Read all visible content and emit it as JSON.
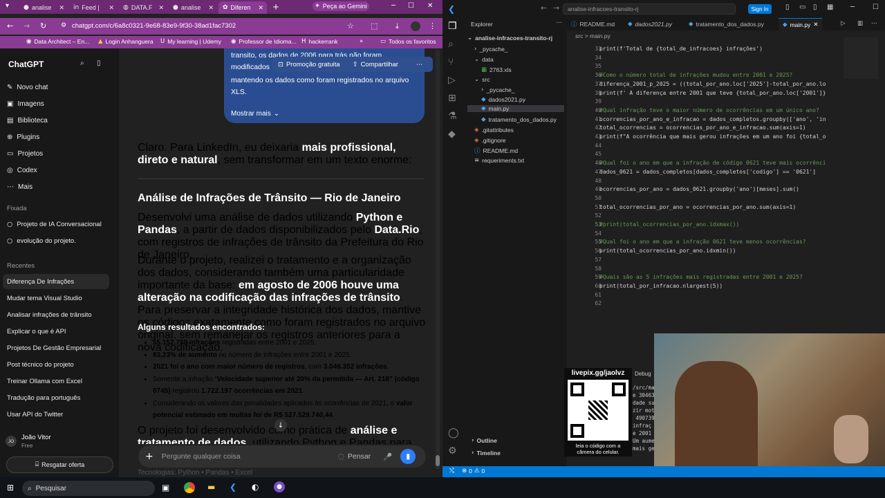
{
  "browser": {
    "tabs": [
      {
        "label": "analise"
      },
      {
        "label": "Feed |"
      },
      {
        "label": "DATA.F"
      },
      {
        "label": "analise"
      },
      {
        "label": "Diferen"
      }
    ],
    "gemini_label": "Peça ao Gemini",
    "url": "chatgpt.com/c/6a8c0321-9e68-83e9-9f30-38ad1fac7302",
    "bookmarks": [
      "Data Architect – En...",
      "Login Anhanguera",
      "My learning | Udemy",
      "Professor de Idioma...",
      "hackerrank",
      "Todos os favoritos"
    ]
  },
  "sidebar": {
    "title": "ChatGPT",
    "nav": [
      "Novo chat",
      "Imagens",
      "Biblioteca",
      "Plugins",
      "Projetos",
      "Codex",
      "Mais"
    ],
    "pinned_header": "Fixada",
    "pinned": [
      "Projeto de IA Conversacional",
      "evolução do projeto."
    ],
    "recent_header": "Recentes",
    "recent": [
      "Diferença De Infrações",
      "Mudar tema Visual Studio",
      "Analisar infrações de trânsito",
      "Explicar o que é API",
      "Projetos De Gestão Empresarial",
      "Post técnico do projeto",
      "Treinar Ollama com Excel",
      "Tradução para português",
      "Usar API do Twitter"
    ],
    "user_initials": "JO",
    "user_name": "João Vitor",
    "user_plan": "Free",
    "offer_button": "Resgatar oferta"
  },
  "chat": {
    "bubble_lines": [
      "transito, os dados de 2006 para trás não foram",
      "modificados",
      "mantendo os dados como foram registrados no arquivo",
      "XLS."
    ],
    "promo_label": "Promoção gratuita",
    "share_label": "Compartilhar",
    "show_more": "Mostrar mais",
    "intro_a": "Claro. Para LinkedIn, eu deixaria ",
    "intro_b": "mais profissional, direto e natural",
    "intro_c": ", sem transformar em um texto enorme:",
    "post_title": "Análise de Infrações de Trânsito — Rio de Janeiro",
    "p1_a": "Desenvolvi uma análise de dados utilizando ",
    "p1_b": "Python e Pandas",
    "p1_c": ", a partir de dados disponibilizados pelo ",
    "p1_d": "Data.Rio",
    "p1_e": ", com registros de infrações de trânsito da Prefeitura do Rio de Janeiro.",
    "p2_a": "Durante o projeto, realizei o tratamento e a organização dos dados, considerando também uma particularidade importante da base: ",
    "p2_b": "em agosto de 2006 houve uma alteração na codificação das infrações de trânsito",
    "p2_c": ". Para preservar a integridade histórica dos dados, mantive os códigos exatamente como foram registrados no arquivo original, sem remanejar os registros anteriores para a nova codificação.",
    "results_title": "Alguns resultados encontrados:",
    "r1_b": "55.152.759 infrações",
    "r1_t": " registradas entre 2001 e 2025.",
    "r2_b": "83,23% de aumento",
    "r2_t": " no número de infrações entre 2001 e 2025.",
    "r3_b": "2021 foi o ano com maior número de registros",
    "r3_t": ", com ",
    "r3_b2": "3.046.352 infrações",
    "r4_t": "Somente a infração “",
    "r4_b": "Velocidade superior até 20% da permitida — Art. 218”",
    "r4_b2": "(código 0745)",
    "r4_t2": " registrou ",
    "r4_b3": "1.722.197 ocorrências em 2021",
    "r5_t": "Considerando os valores das penalidades aplicados às ocorrências de 2021, o ",
    "r5_b": "valor potencial estimado em multas foi de R$ 527.529.740,44",
    "p3_a": "O projeto foi desenvolvido como prática de ",
    "p3_b": "análise e tratamento de dados",
    "p3_c": ", utilizando Python e Pandas para transformar uma base extensa em informações que podem ser",
    "tech_line": "Tecnologias: Python • Pandas • Excel",
    "input_placeholder": "Pergunte qualquer coisa",
    "think_label": "Pensar"
  },
  "vscode": {
    "title": "analise-infracoes-transito-rj",
    "signin": "Sign In",
    "explorer_title": "Explorer",
    "project": "analise-infracoes-transito-rj",
    "tree": [
      "_pycache_",
      "data",
      "2763.xls",
      "src",
      "_pycache_",
      "dados2021.py",
      "main.py",
      "tratamento_dos_dados.py",
      ".gitattributes",
      ".gitignore",
      "README.md",
      "requeriments.txt"
    ],
    "outline": "Outline",
    "timeline": "Timeline",
    "tabs": [
      "README.md",
      "dados2021.py",
      "tratamento_dos_dados.py",
      "main.py"
    ],
    "breadcrumb": "src > main.py",
    "line_numbers": [
      "33",
      "34",
      "35",
      "36",
      "37",
      "38",
      "39",
      "40",
      "41",
      "42",
      "43",
      "44",
      "45",
      "46",
      "47",
      "48",
      "49",
      "50",
      "51",
      "52",
      "53",
      "54",
      "55",
      "56",
      "57",
      "58",
      "59",
      "60",
      "61",
      "62"
    ],
    "code_lines": [
      "print(f'Total de {total_de_infracoes} infrações')",
      "",
      "",
      "#Como o número total de infrações mudou entre 2001 e 2025?",
      "diferença_2001_p_2025 = ((total_por_ano.loc['2025']-total_por_ano.lo",
      "print(f' A diferença entre 2001 que teve {total_por_ano.loc['2001']}",
      "",
      "#Qual infração teve o maior número de ocorrências em um único ano?",
      "ocorrencias_por_ano_e_infracao = dados_completos.groupby(['ano', 'in",
      "total_ocorrencias = ocorrencias_por_ano_e_infracao.sum(axis=1)",
      "print(f\"A ocorrência que mais gerou infrações em um ano foi {total_o",
      "",
      "",
      "#Qual foi o ano em que a infração de código 0621 teve mais ocorrênci",
      "dados_0621 = dados_completos[dados_completos['codigo'] == '0621']",
      "",
      "ocorrencias_por_ano = dados_0621.groupby('ano')[meses].sum()",
      "",
      "total_ocorrencias_por_ano = ocorrencias_por_ano.sum(axis=1)",
      "",
      "#print(total_ocorrencias_por_ano.idxmax())",
      "",
      "#Qual foi o ano em que a infração 0621 teve menos ocorrências?",
      "print(total_ocorrencias_por_ano.idxmin())",
      "",
      "",
      "#Quais são as 5 infrações mais registradas entre 2001 e 2025?",
      "print(total_por_infracao.nlargest(5))",
      "",
      ""
    ],
    "debug_label": "Debug",
    "debug_lines": [
      "/src/ma",
      "e 30463",
      "dade su",
      "zir mot",
      " 490739",
      "infraç",
      "e 2001",
      "Um aume",
      "mais ge"
    ],
    "status_errors": "0",
    "status_warnings": "0"
  },
  "qr": {
    "url": "livepix.gg/jaolvz",
    "caption": "leia o código com a câmera do celular."
  },
  "taskbar": {
    "search": "Pesquisar"
  }
}
